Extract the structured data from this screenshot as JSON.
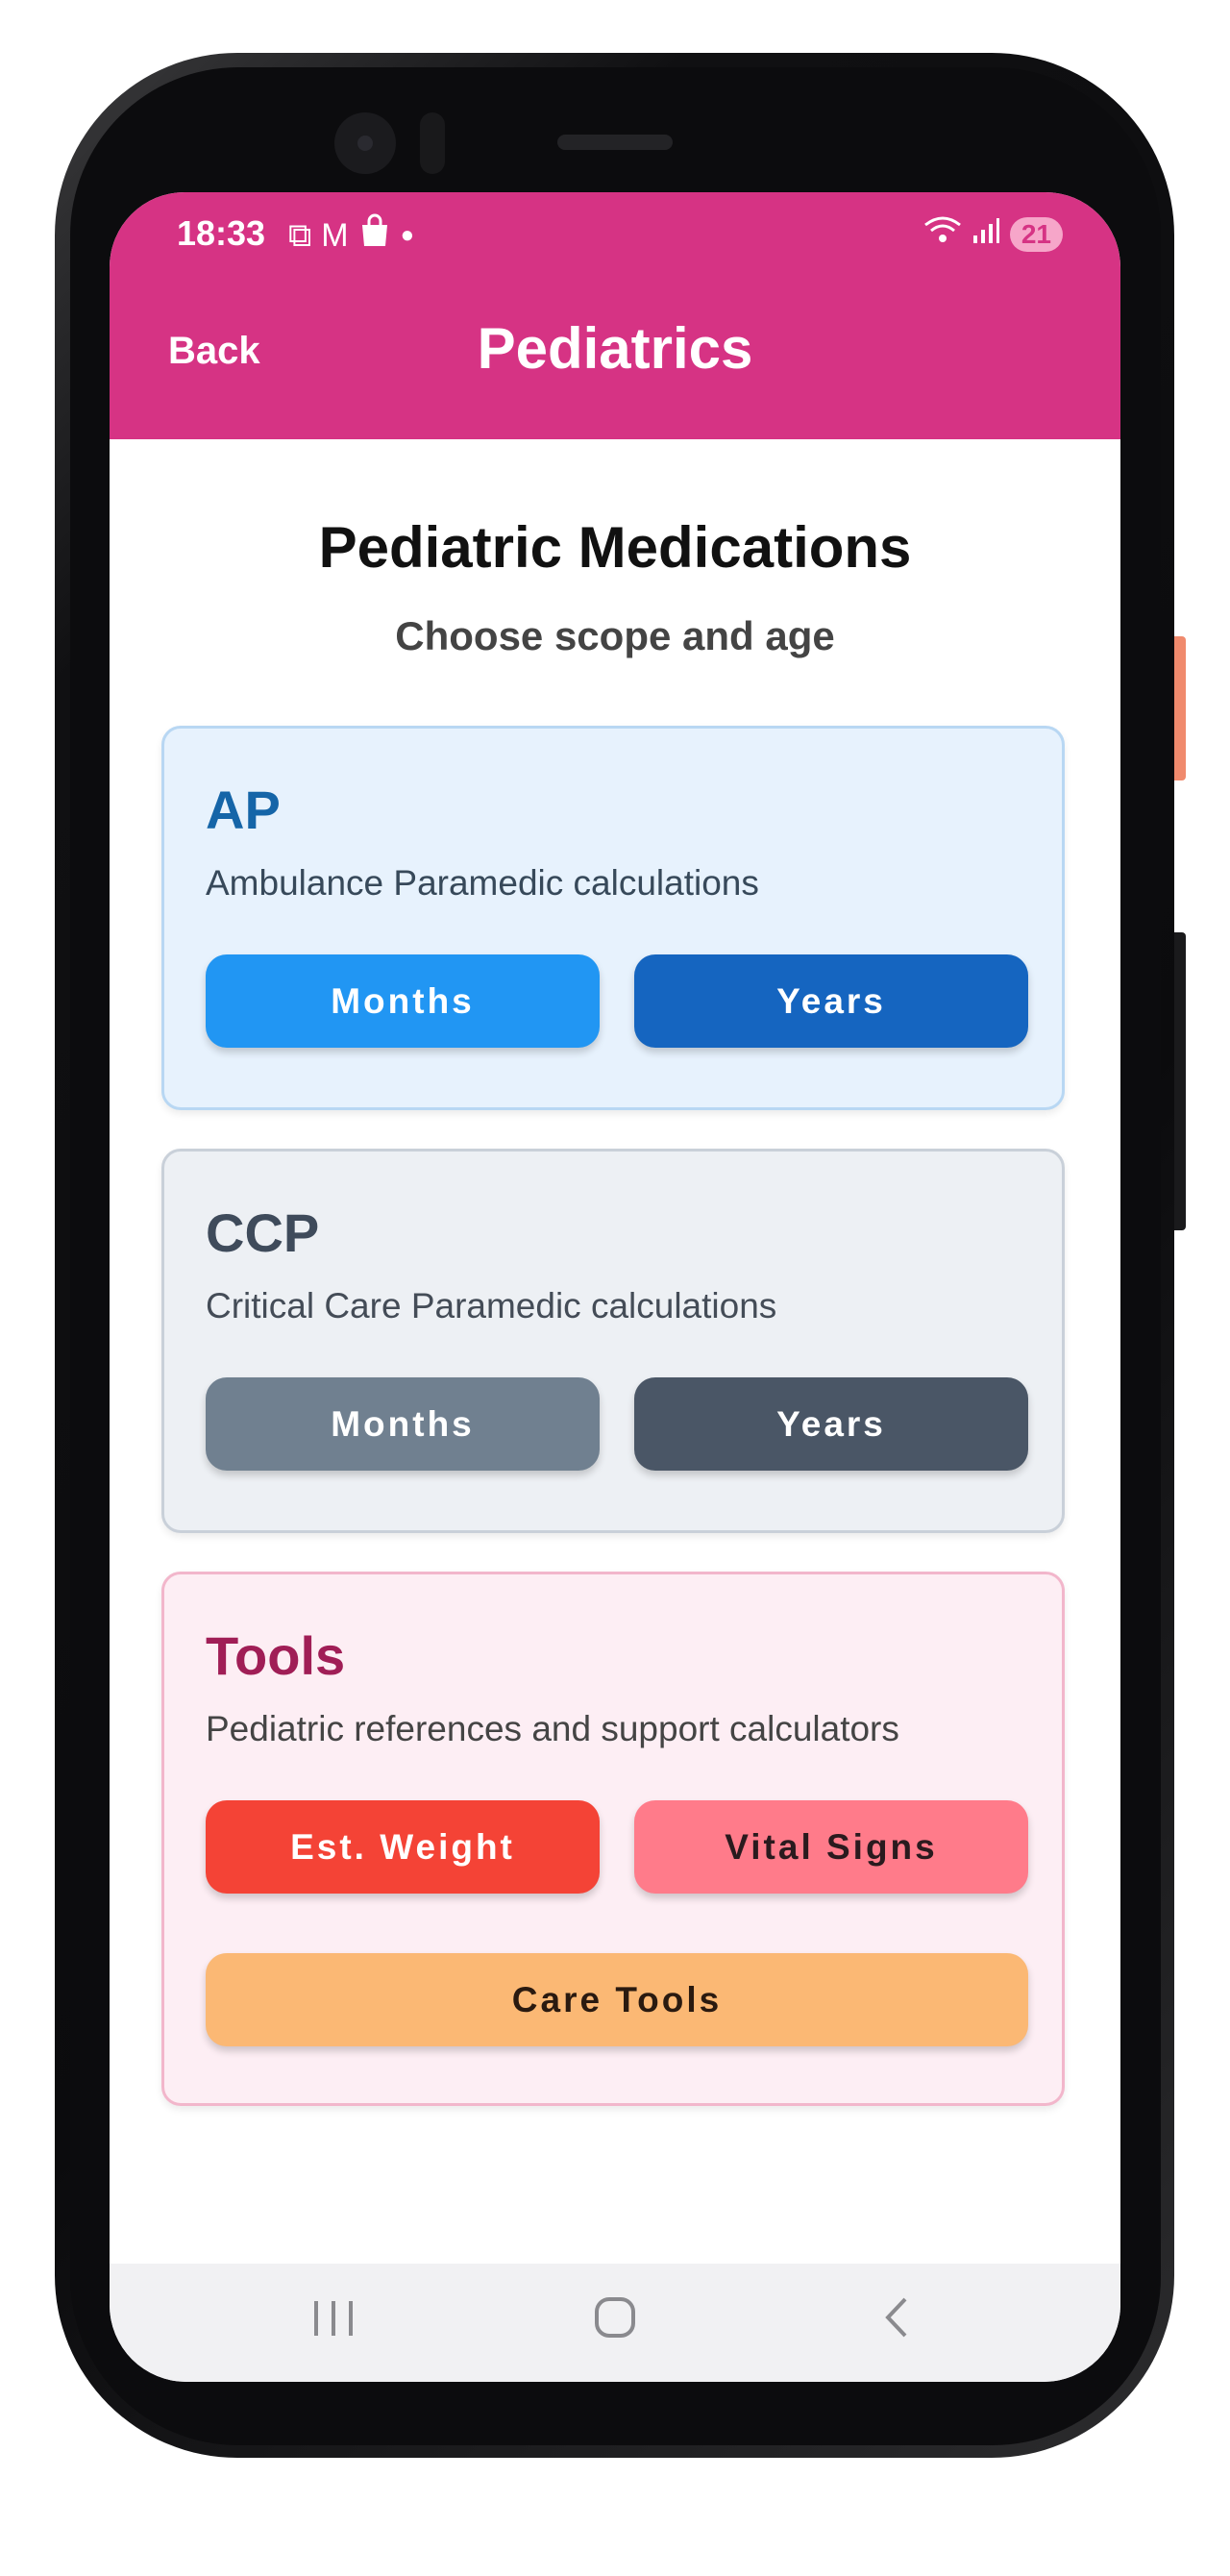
{
  "status_bar": {
    "time": "18:33",
    "battery": "21"
  },
  "header": {
    "back_label": "Back",
    "title": "Pediatrics",
    "color": "#d63384"
  },
  "page": {
    "title": "Pediatric Medications",
    "subtitle": "Choose scope and age"
  },
  "cards": {
    "ap": {
      "title": "AP",
      "description": "Ambulance Paramedic calculations",
      "months_label": "Months",
      "years_label": "Years"
    },
    "ccp": {
      "title": "CCP",
      "description": "Critical Care Paramedic calculations",
      "months_label": "Months",
      "years_label": "Years"
    },
    "tools": {
      "title": "Tools",
      "description": "Pediatric references and support calculators",
      "est_weight_label": "Est. Weight",
      "vital_signs_label": "Vital Signs",
      "care_tools_label": "Care Tools"
    }
  },
  "colors": {
    "ap_months": "#2196f3",
    "ap_years": "#1565c0",
    "ccp_months": "#708090",
    "ccp_years": "#4a5666",
    "est_weight": "#f44336",
    "vital_signs": "#ff7b8a",
    "care_tools": "#fbb874"
  },
  "nav_icons": [
    "recent-apps-icon",
    "home-icon",
    "back-icon"
  ]
}
